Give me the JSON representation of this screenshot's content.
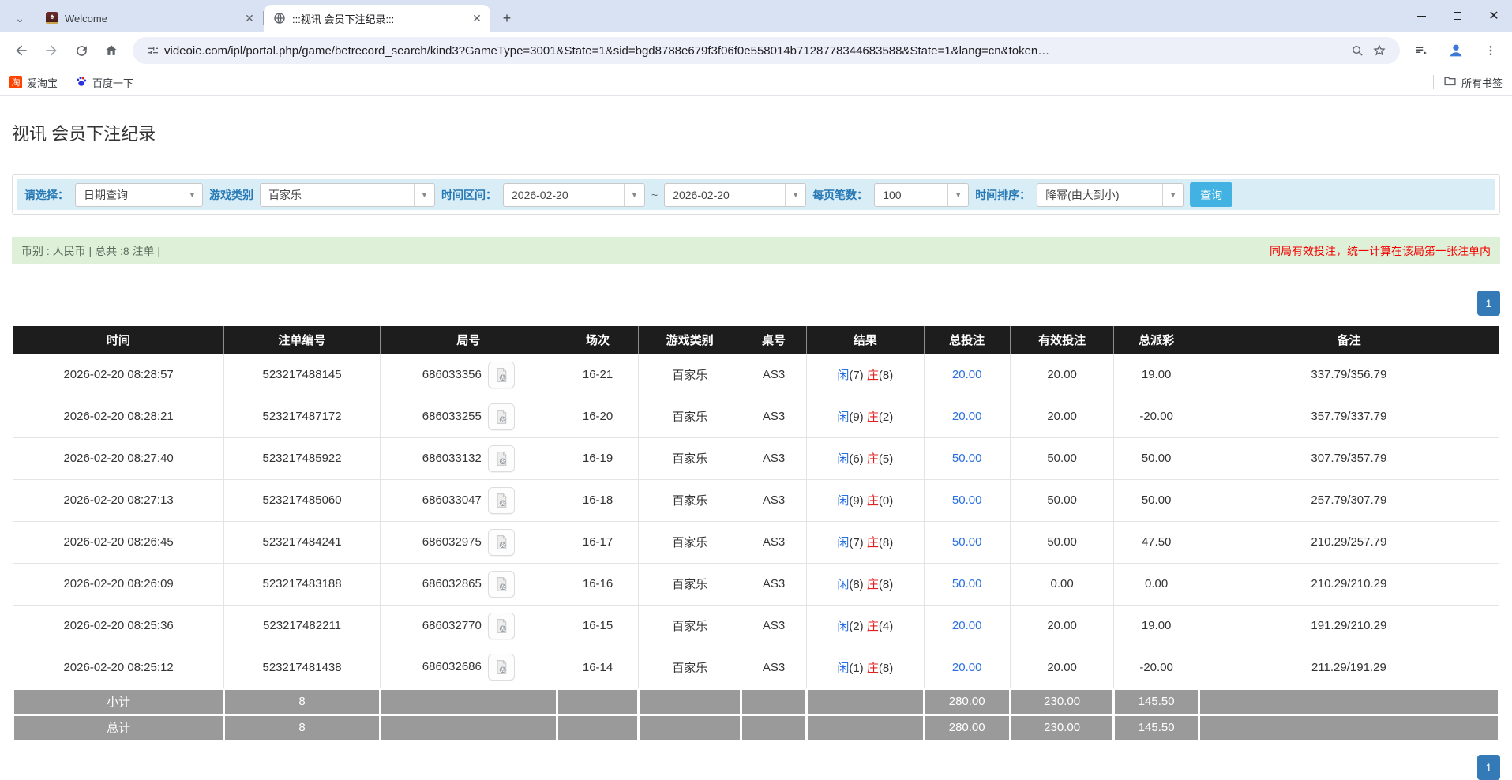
{
  "browser": {
    "tabs": [
      {
        "title": "Welcome",
        "favicon": "spade-card-icon",
        "icon_char": "♠"
      },
      {
        "title": ":::视讯 会员下注纪录:::",
        "favicon": "globe-icon"
      }
    ],
    "url": "videoie.com/ipl/portal.php/game/betrecord_search/kind3?GameType=3001&State=1&sid=bgd8788e679f3f06f0e558014b7128778344683588&State=1&lang=cn&token…",
    "bookmarks": [
      {
        "label": "爱淘宝",
        "icon_char": "淘"
      },
      {
        "label": "百度一下"
      }
    ],
    "all_bookmarks_label": "所有书签"
  },
  "page": {
    "title": "视讯 会员下注纪录",
    "filters": {
      "select_label": "请选择：",
      "select_value": "日期查询",
      "game_type_label": "游戏类别",
      "game_type_value": "百家乐",
      "range_label": "时间区间：",
      "date_from": "2026-02-20",
      "tilde": "~",
      "date_to": "2026-02-20",
      "per_page_label": "每页笔数：",
      "per_page_value": "100",
      "sort_label": "时间排序：",
      "sort_value": "降幂(由大到小)",
      "search_button": "查询"
    },
    "summary": {
      "left": "币别 : 人民币 | 总共 :8 注单 |",
      "right": "同局有效投注，统一计算在该局第一张注单内"
    },
    "pagination": {
      "page": "1"
    },
    "table": {
      "headers": [
        "时间",
        "注单编号",
        "局号",
        "场次",
        "游戏类别",
        "桌号",
        "结果",
        "总投注",
        "有效投注",
        "总派彩",
        "备注"
      ],
      "rows": [
        {
          "time": "2026-02-20 08:28:57",
          "bet_id": "523217488145",
          "round_id": "686033356",
          "session": "16-21",
          "game": "百家乐",
          "table_no": "AS3",
          "result": {
            "player": "闲",
            "player_pts": "(7)",
            "banker": "庄",
            "banker_pts": "(8)"
          },
          "total_bet": "20.00",
          "valid_bet": "20.00",
          "payout": "19.00",
          "note": "337.79/356.79"
        },
        {
          "time": "2026-02-20 08:28:21",
          "bet_id": "523217487172",
          "round_id": "686033255",
          "session": "16-20",
          "game": "百家乐",
          "table_no": "AS3",
          "result": {
            "player": "闲",
            "player_pts": "(9)",
            "banker": "庄",
            "banker_pts": "(2)"
          },
          "total_bet": "20.00",
          "valid_bet": "20.00",
          "payout": "-20.00",
          "note": "357.79/337.79"
        },
        {
          "time": "2026-02-20 08:27:40",
          "bet_id": "523217485922",
          "round_id": "686033132",
          "session": "16-19",
          "game": "百家乐",
          "table_no": "AS3",
          "result": {
            "player": "闲",
            "player_pts": "(6)",
            "banker": "庄",
            "banker_pts": "(5)"
          },
          "total_bet": "50.00",
          "valid_bet": "50.00",
          "payout": "50.00",
          "note": "307.79/357.79"
        },
        {
          "time": "2026-02-20 08:27:13",
          "bet_id": "523217485060",
          "round_id": "686033047",
          "session": "16-18",
          "game": "百家乐",
          "table_no": "AS3",
          "result": {
            "player": "闲",
            "player_pts": "(9)",
            "banker": "庄",
            "banker_pts": "(0)"
          },
          "total_bet": "50.00",
          "valid_bet": "50.00",
          "payout": "50.00",
          "note": "257.79/307.79"
        },
        {
          "time": "2026-02-20 08:26:45",
          "bet_id": "523217484241",
          "round_id": "686032975",
          "session": "16-17",
          "game": "百家乐",
          "table_no": "AS3",
          "result": {
            "player": "闲",
            "player_pts": "(7)",
            "banker": "庄",
            "banker_pts": "(8)"
          },
          "total_bet": "50.00",
          "valid_bet": "50.00",
          "payout": "47.50",
          "note": "210.29/257.79"
        },
        {
          "time": "2026-02-20 08:26:09",
          "bet_id": "523217483188",
          "round_id": "686032865",
          "session": "16-16",
          "game": "百家乐",
          "table_no": "AS3",
          "result": {
            "player": "闲",
            "player_pts": "(8)",
            "banker": "庄",
            "banker_pts": "(8)"
          },
          "total_bet": "50.00",
          "valid_bet": "0.00",
          "payout": "0.00",
          "note": "210.29/210.29"
        },
        {
          "time": "2026-02-20 08:25:36",
          "bet_id": "523217482211",
          "round_id": "686032770",
          "session": "16-15",
          "game": "百家乐",
          "table_no": "AS3",
          "result": {
            "player": "闲",
            "player_pts": "(2)",
            "banker": "庄",
            "banker_pts": "(4)"
          },
          "total_bet": "20.00",
          "valid_bet": "20.00",
          "payout": "19.00",
          "note": "191.29/210.29"
        },
        {
          "time": "2026-02-20 08:25:12",
          "bet_id": "523217481438",
          "round_id": "686032686",
          "session": "16-14",
          "game": "百家乐",
          "table_no": "AS3",
          "result": {
            "player": "闲",
            "player_pts": "(1)",
            "banker": "庄",
            "banker_pts": "(8)"
          },
          "total_bet": "20.00",
          "valid_bet": "20.00",
          "payout": "-20.00",
          "note": "211.29/191.29"
        }
      ],
      "subtotal": {
        "label": "小计",
        "count": "8",
        "total_bet": "280.00",
        "valid_bet": "230.00",
        "payout": "145.50"
      },
      "grand_total": {
        "label": "总计",
        "count": "8",
        "total_bet": "280.00",
        "valid_bet": "230.00",
        "payout": "145.50"
      }
    },
    "colors": {
      "header_bg": "#1d1d1d",
      "footer_bg": "#9a9a9a",
      "filter_bar_bg": "#d9edf7",
      "summary_bg": "#dff0d8",
      "accent_blue": "#2a6fe0",
      "negative_red": "#f00000",
      "search_button_bg": "#41b2e1",
      "pagination_bg": "#337ab7"
    }
  }
}
